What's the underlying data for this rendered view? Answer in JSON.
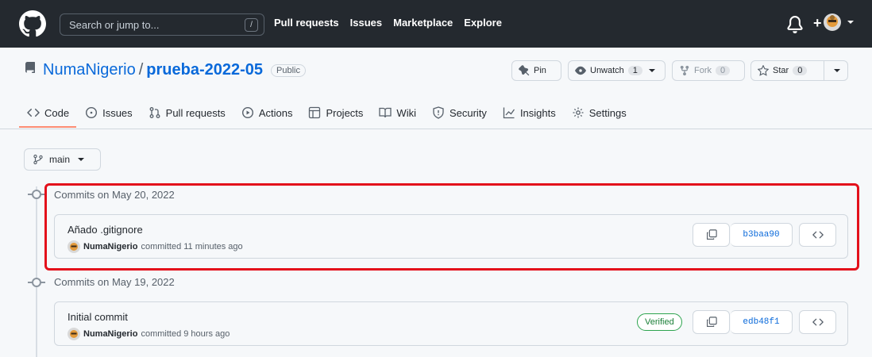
{
  "topbar": {
    "search_placeholder": "Search or jump to...",
    "search_shortcut": "/",
    "nav": [
      "Pull requests",
      "Issues",
      "Marketplace",
      "Explore"
    ],
    "plus": "+"
  },
  "repo": {
    "owner": "NumaNigerio",
    "separator": "/",
    "name": "prueba-2022-05",
    "visibility": "Public",
    "pin_label": "Pin",
    "unwatch_label": "Unwatch",
    "unwatch_count": "1",
    "fork_label": "Fork",
    "fork_count": "0",
    "star_label": "Star",
    "star_count": "0"
  },
  "tabs": [
    "Code",
    "Issues",
    "Pull requests",
    "Actions",
    "Projects",
    "Wiki",
    "Security",
    "Insights",
    "Settings"
  ],
  "branch": {
    "label": "main"
  },
  "groups": [
    {
      "heading": "Commits on May 20, 2022",
      "commits": [
        {
          "title": "Añado .gitignore",
          "author": "NumaNigerio",
          "meta": "committed 11 minutes ago",
          "sha": "b3baa90",
          "verified": ""
        }
      ]
    },
    {
      "heading": "Commits on May 19, 2022",
      "commits": [
        {
          "title": "Initial commit",
          "author": "NumaNigerio",
          "meta": "committed 9 hours ago",
          "sha": "edb48f1",
          "verified": "Verified"
        }
      ]
    }
  ],
  "colors": {
    "header_bg": "#24292f",
    "link": "#0969da",
    "tab_underline": "#fd8c73",
    "highlight": "#e3101b",
    "verified": "#1a7f37"
  }
}
